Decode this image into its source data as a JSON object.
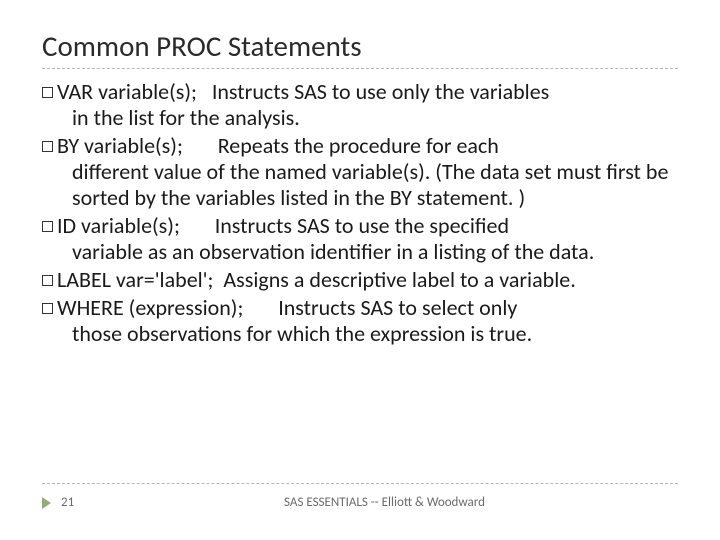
{
  "title": "Common PROC Statements",
  "bullets": [
    {
      "keyword": "VAR variable(s);",
      "gap": "   ",
      "desc_lead": "Instructs SAS to use only the variables",
      "desc_rest": "in the list for the analysis."
    },
    {
      "keyword": "BY variable(s);",
      "gap": "       ",
      "desc_lead": "Repeats the procedure for each",
      "desc_rest": "different value of the named variable(s). (The data set must first be sorted by the variables listed in the BY statement. )"
    },
    {
      "keyword": "ID variable(s);",
      "gap": "       ",
      "desc_lead": "Instructs SAS to use the specified",
      "desc_rest": "variable as an observation identifier in a listing of the data."
    },
    {
      "keyword": "LABEL var='label';",
      "gap": "  ",
      "desc_lead": "Assigns a descriptive label to a variable.",
      "desc_rest": ""
    },
    {
      "keyword": "WHERE (expression);",
      "gap": "       ",
      "desc_lead": "Instructs SAS to select only",
      "desc_rest": "those observations for which the expression is true."
    }
  ],
  "footer": {
    "page": "21",
    "text": "SAS ESSENTIALS -- Elliott & Woodward"
  }
}
